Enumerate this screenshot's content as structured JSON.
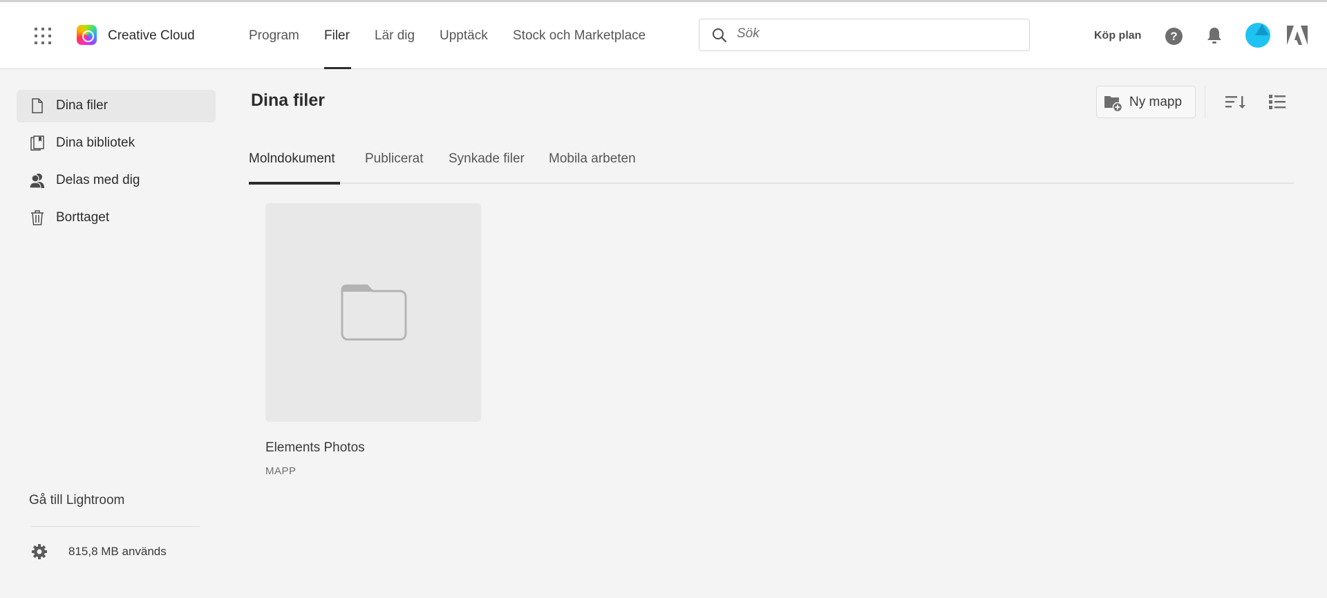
{
  "header": {
    "brand": "Creative Cloud",
    "nav": [
      {
        "label": "Program"
      },
      {
        "label": "Filer",
        "active": true
      },
      {
        "label": "Lär dig"
      },
      {
        "label": "Upptäck"
      },
      {
        "label": "Stock och Marketplace"
      }
    ],
    "search_placeholder": "Sök",
    "buy_plan": "Köp plan",
    "help_glyph": "?"
  },
  "sidebar": {
    "items": [
      {
        "label": "Dina filer",
        "icon": "file-icon",
        "active": true
      },
      {
        "label": "Dina bibliotek",
        "icon": "library-icon"
      },
      {
        "label": "Delas med dig",
        "icon": "shared-users-icon"
      },
      {
        "label": "Borttaget",
        "icon": "trash-icon"
      }
    ],
    "lightroom_link": "Gå till Lightroom",
    "storage_used": "815,8 MB används"
  },
  "main": {
    "title": "Dina filer",
    "new_folder": "Ny mapp",
    "tabs": [
      {
        "label": "Molndokument",
        "active": true
      },
      {
        "label": "Publicerat"
      },
      {
        "label": "Synkade filer"
      },
      {
        "label": "Mobila arbeten"
      }
    ],
    "files": [
      {
        "name": "Elements Photos",
        "type": "MAPP"
      }
    ]
  },
  "colors": {
    "accent_avatar": "#1ec3f2",
    "text": "#2c2c2c",
    "background": "#f4f4f4"
  }
}
